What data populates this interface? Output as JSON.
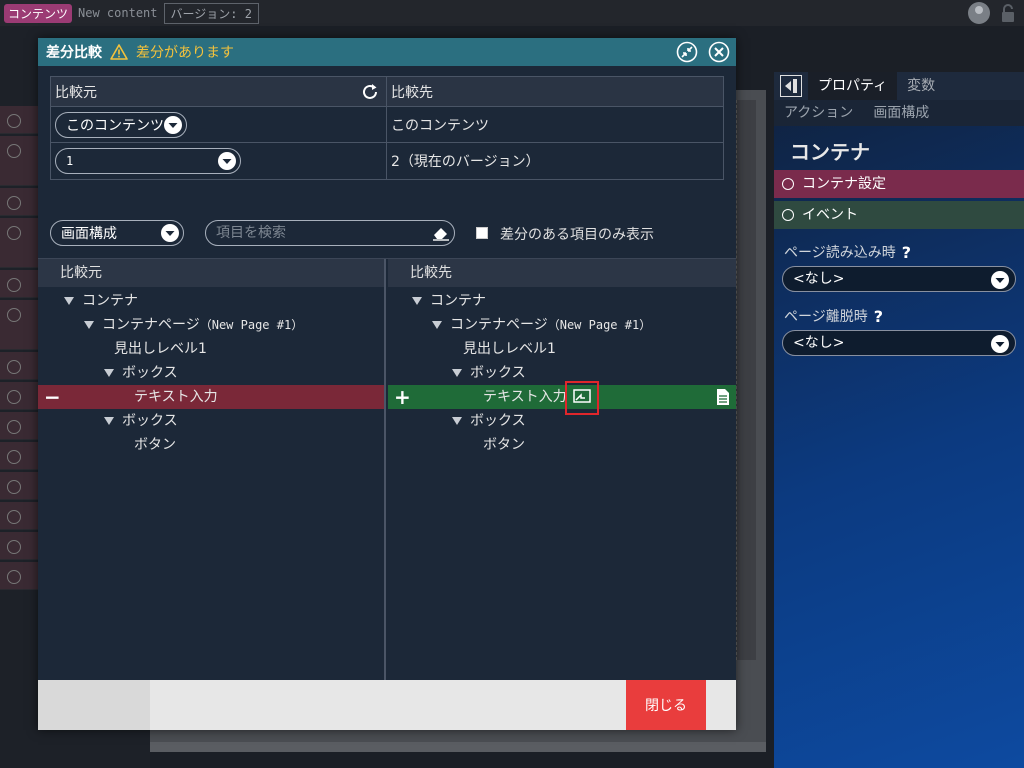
{
  "topbar": {
    "badge": "コンテンツ",
    "new_content": "New content",
    "version": "バージョン: 2"
  },
  "property_panel": {
    "tabs": [
      "プロパティ",
      "変数"
    ],
    "subtabs": [
      "アクション",
      "画面構成"
    ],
    "title": "コンテナ",
    "sections": [
      "コンテナ設定",
      "イベント"
    ],
    "fields": [
      {
        "label": "ページ読み込み時",
        "help": "?",
        "value": "<なし>"
      },
      {
        "label": "ページ離脱時",
        "help": "?",
        "value": "<なし>"
      }
    ]
  },
  "dialog": {
    "title": "差分比較",
    "warning": "差分があります",
    "compare": {
      "source_header": "比較元",
      "target_header": "比較先",
      "source_content": "このコンテンツ",
      "target_content": "このコンテンツ",
      "source_version": "1",
      "target_version": "2（現在のバージョン）"
    },
    "filter": {
      "view_select": "画面構成",
      "search_placeholder": "項目を検索",
      "diff_only_label": "差分のある項目のみ表示"
    },
    "tree": {
      "source_header": "比較元",
      "target_header": "比較先",
      "source_items": [
        {
          "label": "コンテナ",
          "sub": ""
        },
        {
          "label": "コンテナページ",
          "sub": "（New Page #1）"
        },
        {
          "label": "見出しレベル1",
          "sub": ""
        },
        {
          "label": "ボックス",
          "sub": ""
        },
        {
          "label": "テキスト入力",
          "sub": "",
          "diff": "−"
        },
        {
          "label": "ボックス",
          "sub": ""
        },
        {
          "label": "ボタン",
          "sub": ""
        }
      ],
      "target_items": [
        {
          "label": "コンテナ",
          "sub": ""
        },
        {
          "label": "コンテナページ",
          "sub": "（New Page #1）"
        },
        {
          "label": "見出しレベル1",
          "sub": ""
        },
        {
          "label": "ボックス",
          "sub": ""
        },
        {
          "label": "テキスト入力",
          "sub": "",
          "diff": "+"
        },
        {
          "label": "ボックス",
          "sub": ""
        },
        {
          "label": "ボタン",
          "sub": ""
        }
      ]
    },
    "close_label": "閉じる"
  }
}
